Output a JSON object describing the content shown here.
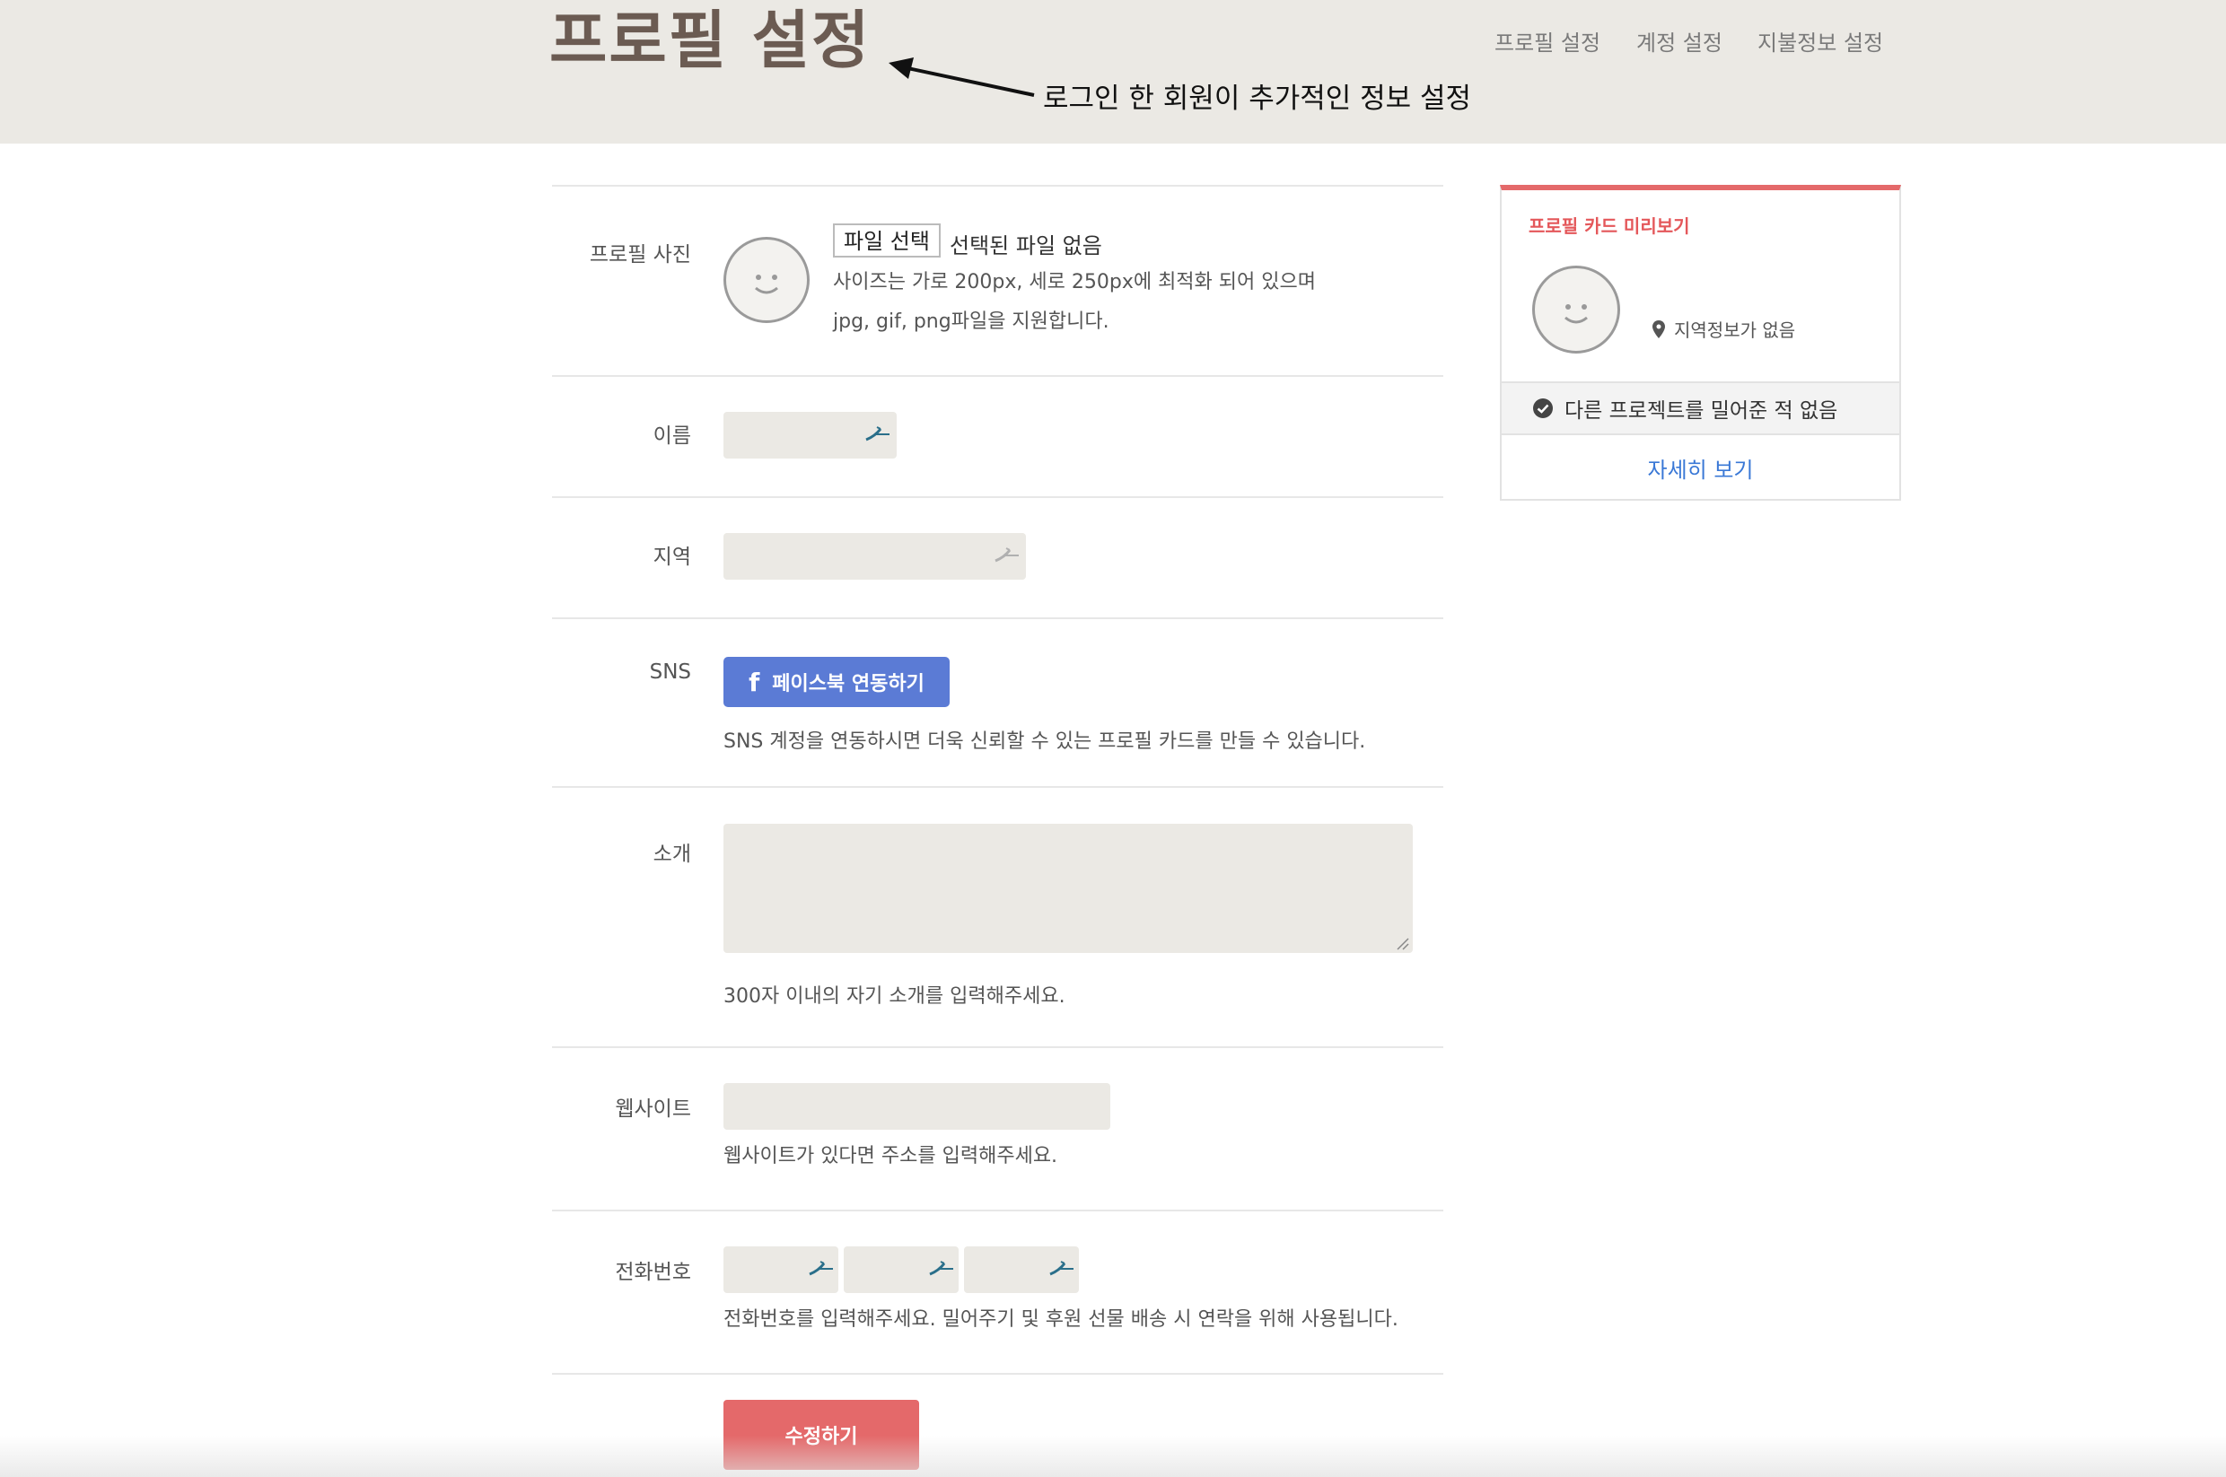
{
  "header": {
    "title": "프로필 설정",
    "nav": [
      {
        "label": "프로필 설정"
      },
      {
        "label": "계정 설정"
      },
      {
        "label": "지불정보 설정"
      }
    ],
    "annotation": "로그인 한 회원이 추가적인 정보 설정"
  },
  "form": {
    "photo": {
      "label": "프로필 사진",
      "file_button": "파일 선택",
      "file_status": "선택된 파일 없음",
      "help_line1": "사이즈는 가로 200px, 세로 250px에 최적화 되어 있으며",
      "help_line2": "jpg, gif, png파일을 지원합니다."
    },
    "name": {
      "label": "이름",
      "value": ""
    },
    "region": {
      "label": "지역",
      "value": ""
    },
    "sns": {
      "label": "SNS",
      "facebook_button": "페이스북 연동하기",
      "help": "SNS 계정을 연동하시면 더욱 신뢰할 수 있는 프로필 카드를 만들 수 있습니다."
    },
    "intro": {
      "label": "소개",
      "value": "",
      "help": "300자 이내의 자기 소개를 입력해주세요."
    },
    "website": {
      "label": "웹사이트",
      "value": "",
      "help": "웹사이트가 있다면 주소를 입력해주세요."
    },
    "phone": {
      "label": "전화번호",
      "parts": [
        "",
        "",
        ""
      ],
      "help": "전화번호를 입력해주세요. 밀어주기 및 후원 선물 배송 시 연락을 위해 사용됩니다."
    },
    "submit": "수정하기"
  },
  "preview_card": {
    "title": "프로필 카드 미리보기",
    "location": "지역정보가 없음",
    "status": "다른 프로젝트를 밀어준 적 없음",
    "link": "자세히 보기"
  },
  "colors": {
    "header_bg": "#ebe9e4",
    "title": "#6b5b52",
    "accent": "#e4696a",
    "facebook": "#5b7bd5",
    "link": "#3a78d6",
    "field_bg": "#ebe9e4"
  },
  "icons": [
    "smiley-avatar-icon",
    "map-pin-icon",
    "check-circle-icon",
    "facebook-f-icon",
    "autofill-key-icon",
    "arrow-icon"
  ]
}
